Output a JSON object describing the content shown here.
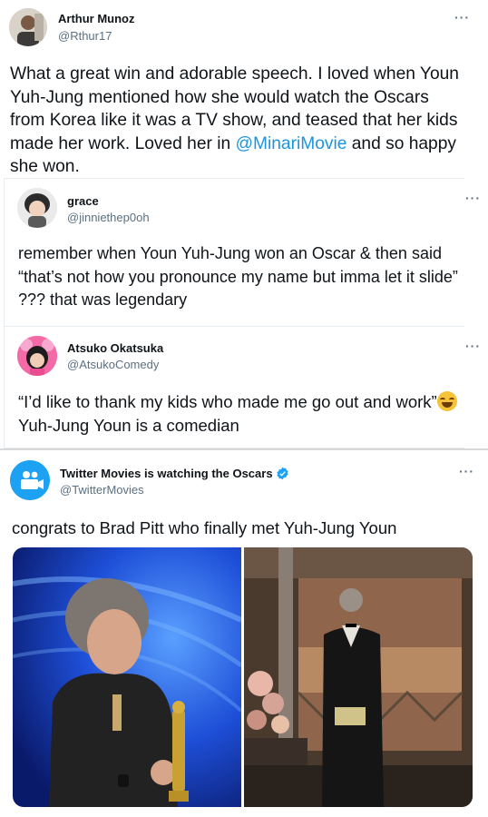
{
  "tweets": [
    {
      "name": "Arthur Munoz",
      "handle": "@Rthur17",
      "more": "···",
      "text_before": "What a great win and adorable speech. I loved when Youn Yuh-Jung mentioned how she would watch the Oscars from Korea like it was a TV show, and teased that her kids made her work. Loved her in ",
      "mention": "@MinariMovie",
      "text_after": " and so happy she won."
    },
    {
      "name": "grace",
      "handle": "@jinniethep0oh",
      "more": "···",
      "text": "remember when Youn Yuh-Jung won an Oscar & then said “that’s not how you pronounce my name but imma let it slide” ??? that was legendary"
    },
    {
      "name": "Atsuko Okatsuka",
      "handle": "@AtsukoComedy",
      "more": "···",
      "text_before": "“I’d like to thank my kids who made me go out and work”",
      "emoji": "face-with-tears-of-joy-icon",
      "text_after": " Yuh-Jung Youn is a comedian"
    },
    {
      "name": "Twitter Movies is watching the Oscars",
      "handle": "@TwitterMovies",
      "more": "···",
      "text": "congrats to Brad Pitt who finally met Yuh-Jung Youn",
      "verified_color": "#1da1f2"
    }
  ],
  "colors": {
    "link": "#1b95e0",
    "secondary": "#5b7083",
    "brand": "#1da1f2"
  }
}
